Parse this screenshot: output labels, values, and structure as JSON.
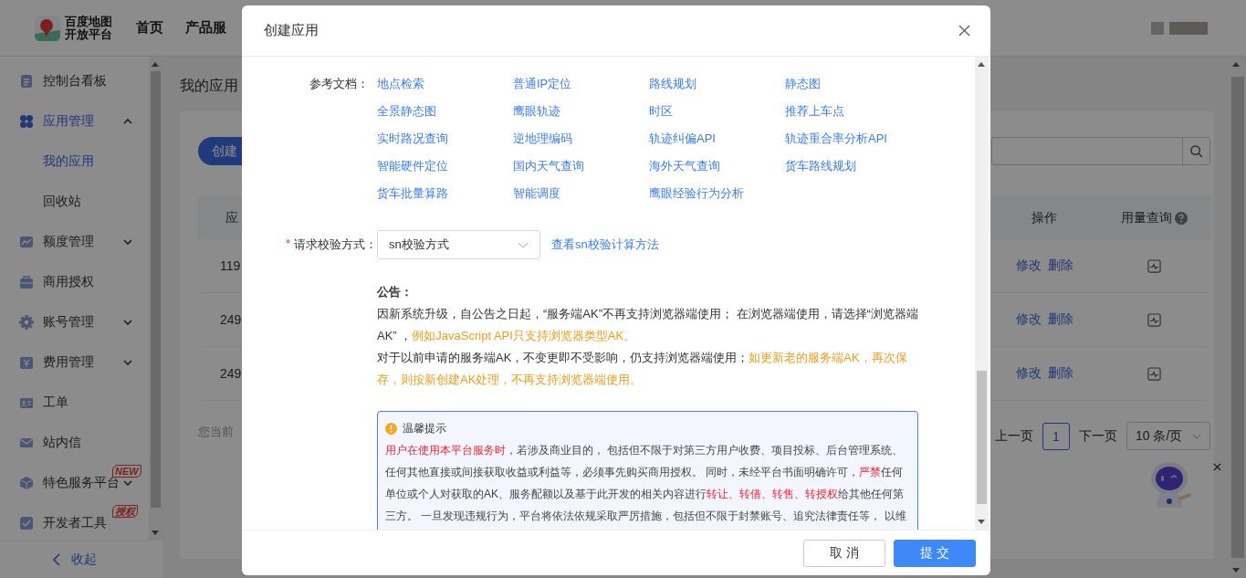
{
  "header": {
    "logo_lines": [
      "百度地图",
      "开放平台"
    ],
    "nav": [
      {
        "label": "首页"
      },
      {
        "label": "产品服"
      }
    ]
  },
  "sidebar": {
    "items": [
      {
        "label": "控制台看板",
        "kind": "item",
        "selected": false
      },
      {
        "label": "应用管理",
        "kind": "group",
        "expanded": true,
        "selected": true,
        "children": [
          {
            "label": "我的应用",
            "selected": true
          },
          {
            "label": "回收站",
            "selected": false
          }
        ]
      },
      {
        "label": "额度管理",
        "kind": "group",
        "expanded": false,
        "selected": false
      },
      {
        "label": "商用授权",
        "kind": "item",
        "selected": false
      },
      {
        "label": "账号管理",
        "kind": "group",
        "expanded": false,
        "selected": false
      },
      {
        "label": "费用管理",
        "kind": "group",
        "expanded": false,
        "selected": false
      },
      {
        "label": "工单",
        "kind": "item",
        "selected": false
      },
      {
        "label": "站内信",
        "kind": "item",
        "selected": false
      },
      {
        "label": "特色服务平台",
        "kind": "group",
        "expanded": false,
        "selected": false,
        "badge": "NEW"
      },
      {
        "label": "开发者工具",
        "kind": "item",
        "selected": false,
        "badge": "授权"
      }
    ],
    "collapse": "收起"
  },
  "page": {
    "title": "我的应用",
    "create_button": "创建",
    "table": {
      "column_1": "应",
      "column_action": "操作",
      "column_usage": "用量查询",
      "rows": [
        {
          "column_1": "119",
          "actions": [
            "修改",
            "删除"
          ]
        },
        {
          "column_1": "249",
          "actions": [
            "修改",
            "删除"
          ]
        },
        {
          "column_1": "249",
          "actions": [
            "修改",
            "删除"
          ]
        }
      ]
    },
    "footer": "您当前",
    "pagination": {
      "prev": "上一页",
      "pages": [
        {
          "label": "1",
          "selected": true
        }
      ],
      "next": "下一页",
      "page_size": "10 条/页"
    }
  },
  "dialog": {
    "title": "创建应用",
    "docs": {
      "label": "参考文档：",
      "links": [
        "地点检索",
        "普通IP定位",
        "路线规划",
        "静态图",
        "全景静态图",
        "鹰眼轨迹",
        "时区",
        "推荐上车点",
        "实时路况查询",
        "逆地理编码",
        "轨迹纠偏API",
        "轨迹重合率分析API",
        "智能硬件定位",
        "国内天气查询",
        "海外天气查询",
        "货车路线规划",
        "货车批量算路",
        "智能调度",
        "鹰眼经验行为分析"
      ]
    },
    "verify": {
      "label": "请求校验方式：",
      "required_mark": "*",
      "value": "sn校验方式",
      "link": "查看sn校验计算方法"
    },
    "notice": {
      "title": "公告：",
      "paragraphs": [
        [
          {
            "text": "因新系统升级，自公告之日起，“服务端AK”不再支持浏览器端使用； 在浏览器端使用，请选择“浏览器端AK” ，",
            "highlight": false
          },
          {
            "text": "例如JavaScript API只支持浏览器类型AK。",
            "highlight": true
          }
        ],
        [
          {
            "text": "对于以前申请的服务端AK，不变更即不受影响，仍支持浏览器端使用；",
            "highlight": false
          },
          {
            "text": "如更新老的服务端AK，再次保存，则按新创建AK处理，不再支持浏览器端使用。",
            "highlight": true
          }
        ]
      ]
    },
    "tips": {
      "title": "温馨提示",
      "segments": [
        {
          "text": "用户在使用本平台服务时",
          "highlight": true
        },
        {
          "text": "，若涉及商业目的， 包括但不限于对第三方用户收费、项目投标、后台管理系统、任何其他直接或间接获取收益或利益等，必须事先购买商用授权。 同时，未经平台书面明确许可，",
          "highlight": false
        },
        {
          "text": "严禁",
          "highlight": true
        },
        {
          "text": "任何单位或个人对获取的AK、服务配额以及基于此开发的相关内容进行",
          "highlight": false
        },
        {
          "text": "转让、转借、转售、转授权",
          "highlight": true
        },
        {
          "text": "给其他任何第三方。 一旦发现违规行为，平台将依法依规采取严厉措施，包括但不限于封禁账号、追究法律责任等， 以维",
          "highlight": false
        }
      ]
    },
    "buttons": [
      {
        "label": "取 消",
        "kind": "secondary"
      },
      {
        "label": "提 交",
        "kind": "primary"
      }
    ]
  }
}
